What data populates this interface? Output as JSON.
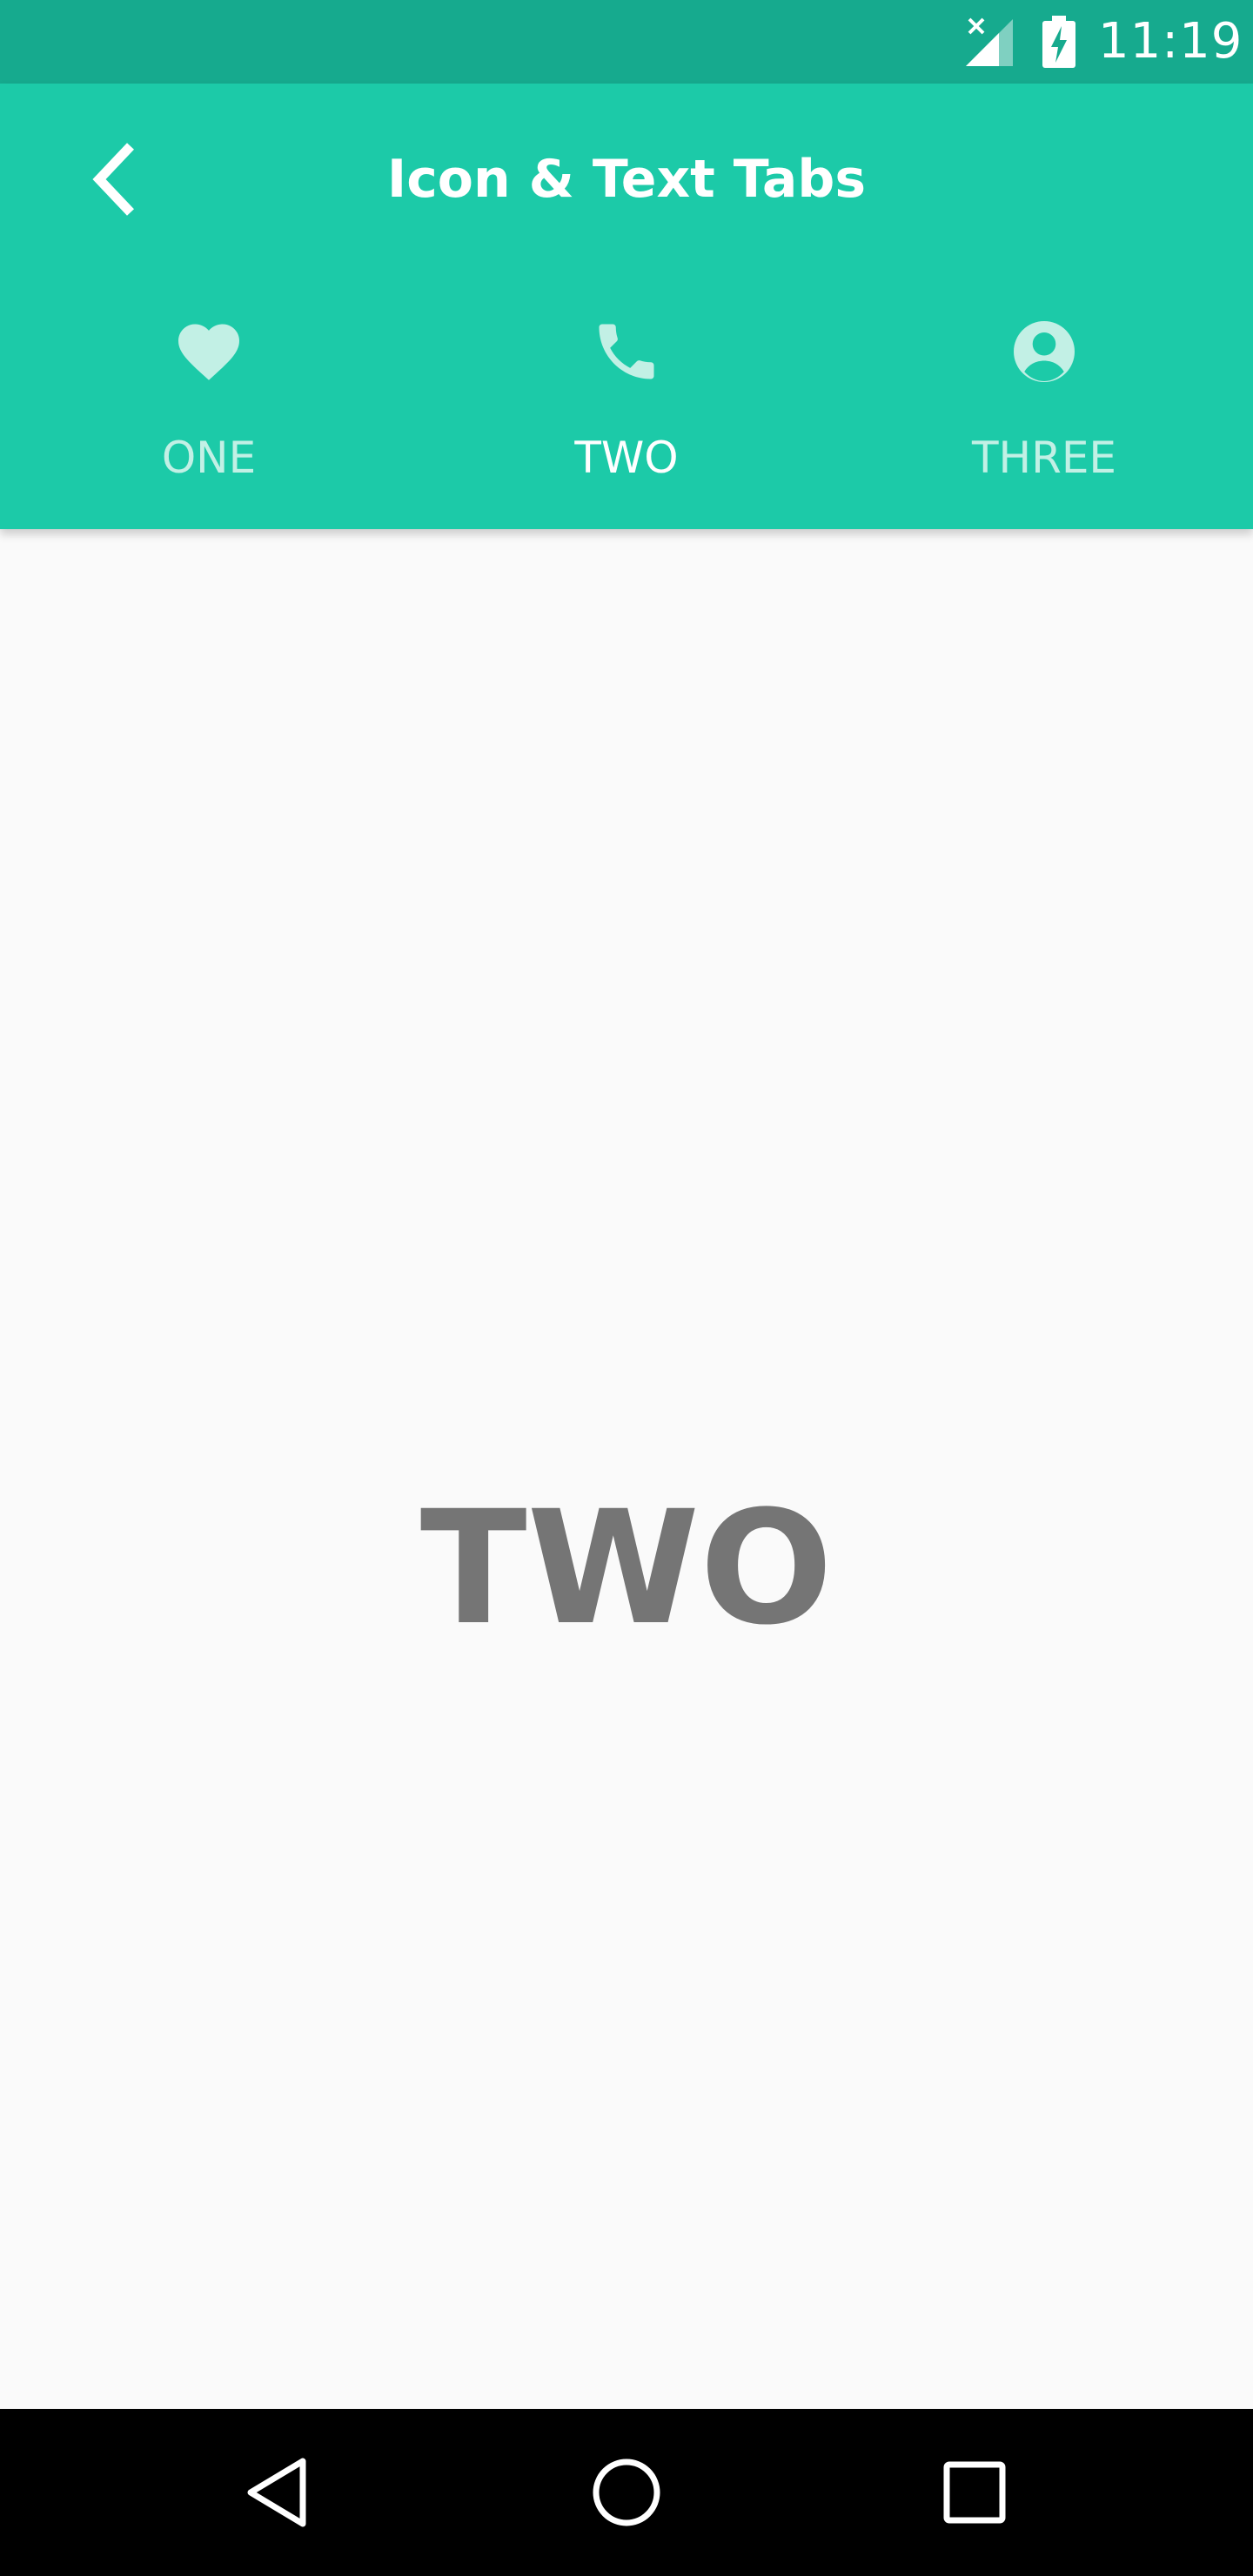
{
  "status_bar": {
    "time": "11:19",
    "signal_icon": "signal-no-data-icon",
    "battery_icon": "battery-charging-icon"
  },
  "app_bar": {
    "title": "Icon & Text Tabs",
    "back_icon": "chevron-left-icon",
    "color": "#1ccaa8"
  },
  "tabs": [
    {
      "label": "ONE",
      "icon": "heart-icon",
      "selected": false
    },
    {
      "label": "TWO",
      "icon": "phone-icon",
      "selected": true
    },
    {
      "label": "THREE",
      "icon": "account-circle-icon",
      "selected": false
    }
  ],
  "content": {
    "text": "TWO"
  },
  "nav_bar": {
    "back_icon": "triangle-back-icon",
    "home_icon": "circle-home-icon",
    "recents_icon": "square-recents-icon"
  },
  "colors": {
    "status_bar": "#16aa8e",
    "app_bar": "#1ccaa8",
    "tab_inactive": "#c2f0e5",
    "tab_active": "#ffffff",
    "content_text": "#757575",
    "background": "#fafafa"
  }
}
